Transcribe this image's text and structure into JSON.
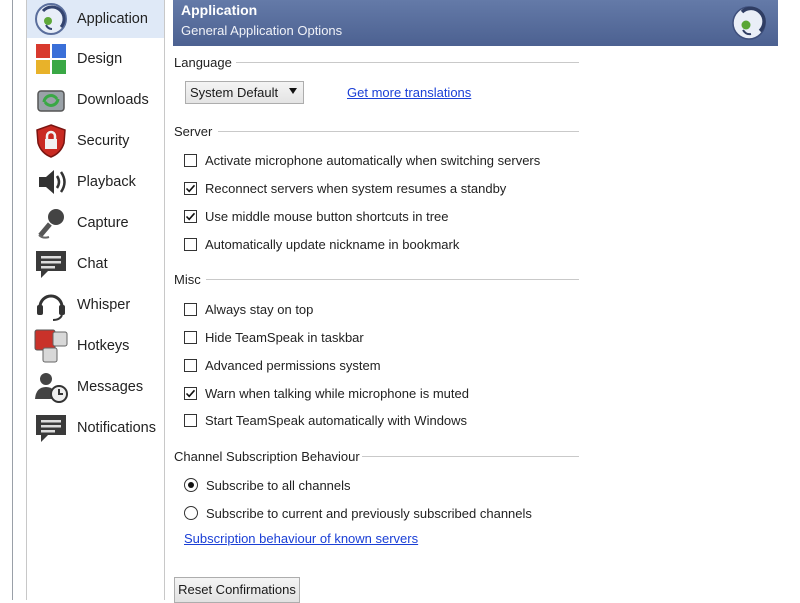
{
  "sidebar": {
    "items": [
      {
        "label": "Application",
        "icon": "application-icon",
        "selected": true
      },
      {
        "label": "Design",
        "icon": "design-icon"
      },
      {
        "label": "Downloads",
        "icon": "downloads-icon"
      },
      {
        "label": "Security",
        "icon": "security-shield-icon"
      },
      {
        "label": "Playback",
        "icon": "speaker-icon"
      },
      {
        "label": "Capture",
        "icon": "microphone-icon"
      },
      {
        "label": "Chat",
        "icon": "chat-icon"
      },
      {
        "label": "Whisper",
        "icon": "headset-icon"
      },
      {
        "label": "Hotkeys",
        "icon": "hotkeys-icon"
      },
      {
        "label": "Messages",
        "icon": "messages-icon"
      },
      {
        "label": "Notifications",
        "icon": "notifications-icon"
      }
    ]
  },
  "header": {
    "title": "Application",
    "subtitle": "General Application Options",
    "logo_icon": "teamspeak-logo-icon"
  },
  "language": {
    "group_label": "Language",
    "selected": "System Default",
    "link": "Get more translations"
  },
  "server": {
    "group_label": "Server",
    "options": [
      {
        "label": "Activate microphone automatically when switching servers",
        "checked": false
      },
      {
        "label": "Reconnect servers when system resumes a standby",
        "checked": true
      },
      {
        "label": "Use middle mouse button shortcuts in tree",
        "checked": true
      },
      {
        "label": "Automatically update nickname in bookmark",
        "checked": false
      }
    ]
  },
  "misc": {
    "group_label": "Misc",
    "options": [
      {
        "label": "Always stay on top",
        "checked": false
      },
      {
        "label": "Hide TeamSpeak in taskbar",
        "checked": false
      },
      {
        "label": "Advanced permissions system",
        "checked": false
      },
      {
        "label": "Warn when talking while microphone is muted",
        "checked": true
      },
      {
        "label": "Start TeamSpeak automatically with Windows",
        "checked": false
      }
    ]
  },
  "subscription": {
    "group_label": "Channel Subscription Behaviour",
    "options": [
      {
        "label": "Subscribe to all channels",
        "selected": true
      },
      {
        "label": "Subscribe to current and previously subscribed channels",
        "selected": false
      }
    ],
    "link": "Subscription behaviour of known servers"
  },
  "reset_button": "Reset Confirmations",
  "colors": {
    "header_bg": "#566b9c",
    "selected_bg": "#dfe9f7",
    "link": "#1a3fd6"
  }
}
